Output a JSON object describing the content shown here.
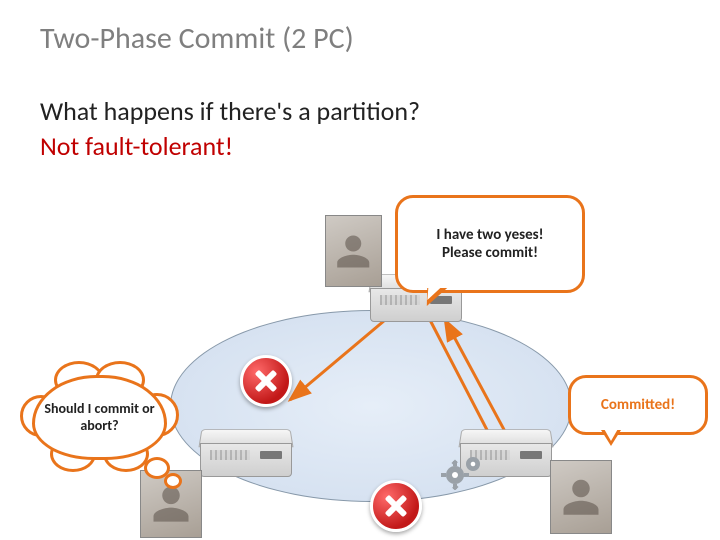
{
  "title": "Two-Phase Commit (2 PC)",
  "subtitle_line1": "What happens if there's a partition?",
  "subtitle_line2": "Not fault-tolerant!",
  "bubbles": {
    "coordinator": "I have two yeses!\nPlease commit!",
    "left_thought": "Should I commit or abort?",
    "right_reply": "Committed!"
  },
  "colors": {
    "accent": "#e9741b",
    "danger": "#c00000",
    "title_gray": "#7f7f7f"
  },
  "people": {
    "coordinator": "coordinator-user",
    "left_participant": "participant-a",
    "right_participant": "participant-b"
  }
}
